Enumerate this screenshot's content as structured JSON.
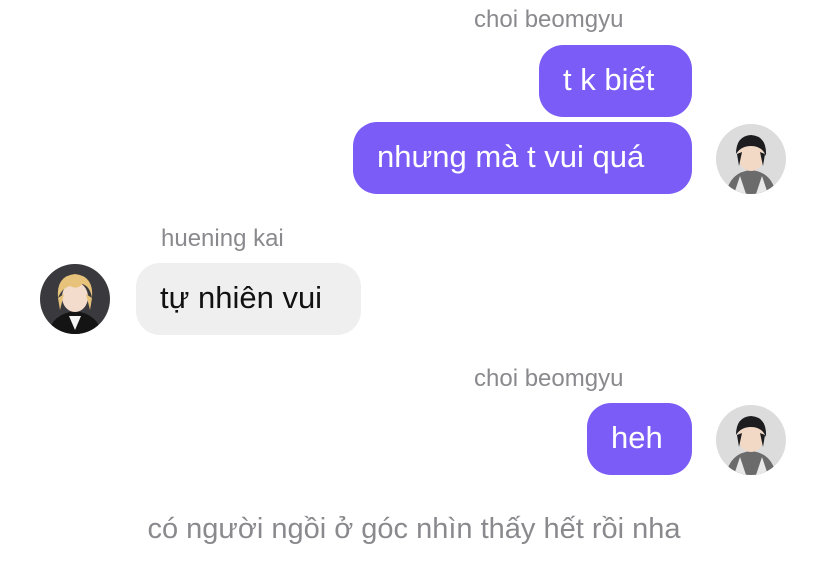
{
  "messages": {
    "group1": {
      "sender": "choi beomgyu",
      "bubble1": "t k biết",
      "bubble2": "nhưng mà t vui quá"
    },
    "group2": {
      "sender": "huening kai",
      "bubble1": "tự nhiên vui"
    },
    "group3": {
      "sender": "choi beomgyu",
      "bubble1": "heh"
    }
  },
  "system_note": "có người ngồi ở góc nhìn thấy hết rồi nha",
  "colors": {
    "outgoing_bubble": "#7b5cf6",
    "incoming_bubble": "#efefef",
    "meta_text": "#8a8a8e"
  }
}
